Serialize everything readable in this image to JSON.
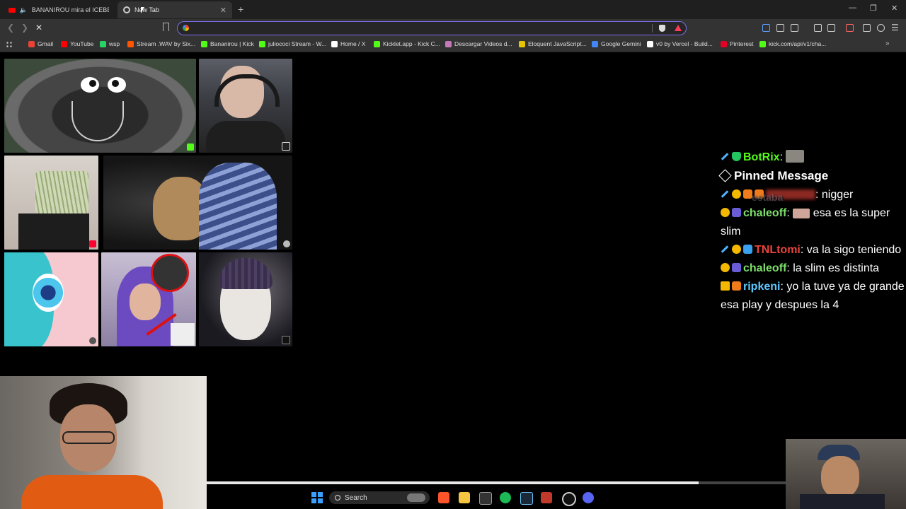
{
  "tabs": [
    {
      "title": "BANANIROU mira el ICEBERG de",
      "active": false
    },
    {
      "title": "New Tab",
      "active": true
    }
  ],
  "toolbar": {
    "address_value": "",
    "address_placeholder": ""
  },
  "bookmarks": [
    {
      "label": "Gmail",
      "color": "#ea4335"
    },
    {
      "label": "YouTube",
      "color": "#ff0000"
    },
    {
      "label": "wsp",
      "color": "#25d366"
    },
    {
      "label": "Stream .WAV by Six...",
      "color": "#ff5500"
    },
    {
      "label": "Bananirou | Kick",
      "color": "#53fc18"
    },
    {
      "label": "juliococi Stream - W...",
      "color": "#53fc18"
    },
    {
      "label": "Home / X",
      "color": "#ffffff"
    },
    {
      "label": "Kicklet.app - Kick C...",
      "color": "#53fc18"
    },
    {
      "label": "Descargar Videos d...",
      "color": "#c47ab8"
    },
    {
      "label": "Eloquent JavaScript...",
      "color": "#e7c500"
    },
    {
      "label": "Google Gemini",
      "color": "#4285f4"
    },
    {
      "label": "v0 by Vercel - Build...",
      "color": "#ffffff"
    },
    {
      "label": "Pinterest",
      "color": "#e60023"
    },
    {
      "label": "kick.com/api/v1/cha...",
      "color": "#53fc18"
    }
  ],
  "chat": {
    "bot": {
      "user": "BotRix",
      "user_color": "#53fc18"
    },
    "pinned_label": "Pinned Message",
    "pinned_ghost": "estaba",
    "messages": [
      {
        "user": "",
        "text": ": nigger",
        "user_color": "#e8443a"
      },
      {
        "user": "chaleoff",
        "text": "esa es la super slim",
        "user_color": "#7ee06b"
      },
      {
        "user": "TNLtomi",
        "text": ": va la sigo teniendo",
        "user_color": "#e8443a"
      },
      {
        "user": "chaleoff",
        "text": ": la slim es distinta",
        "user_color": "#7ee06b"
      },
      {
        "user": "ripkeni",
        "text": ": yo la tuve ya de grande esa play y despues la 4",
        "user_color": "#5ec8ff"
      }
    ]
  },
  "taskbar": {
    "search_label": "Search"
  },
  "video": {
    "progress": 0.85
  }
}
